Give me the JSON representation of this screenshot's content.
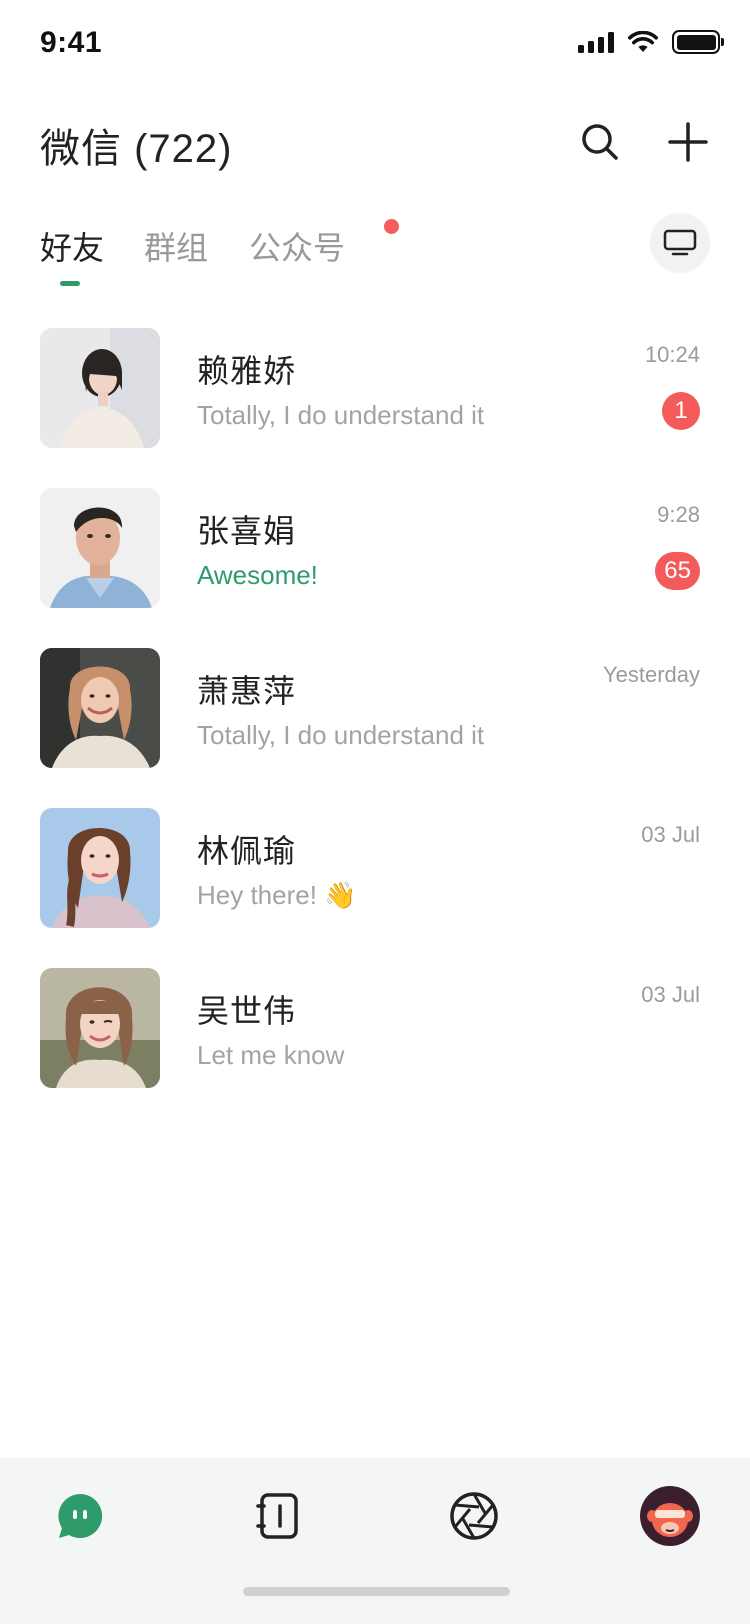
{
  "status_bar": {
    "time": "9:41"
  },
  "header": {
    "title": "微信 (722)",
    "search_icon": "search-icon",
    "add_icon": "plus-icon"
  },
  "tabs": [
    {
      "label": "好友",
      "active": true
    },
    {
      "label": "群组",
      "active": false
    },
    {
      "label": "公众号",
      "active": false,
      "has_dot": true
    }
  ],
  "tv_icon": "monitor-icon",
  "chats": [
    {
      "name": "赖雅娇",
      "preview": "Totally, I do understand it",
      "time": "10:24",
      "unread": "1",
      "preview_accent": false
    },
    {
      "name": "张喜娟",
      "preview": "Awesome!",
      "time": "9:28",
      "unread": "65",
      "preview_accent": true
    },
    {
      "name": "萧惠萍",
      "preview": "Totally, I do understand it",
      "time": "Yesterday",
      "unread": "",
      "preview_accent": false
    },
    {
      "name": "林佩瑜",
      "preview": "Hey there! 👋",
      "time": "03 Jul",
      "unread": "",
      "preview_accent": false
    },
    {
      "name": "吴世伟",
      "preview": "Let me know",
      "time": "03 Jul",
      "unread": "",
      "preview_accent": false
    }
  ],
  "bottom_nav": [
    {
      "icon": "chat-bubble-icon",
      "active": true
    },
    {
      "icon": "contacts-book-icon",
      "active": false
    },
    {
      "icon": "camera-aperture-icon",
      "active": false
    },
    {
      "icon": "monkey-avatar-icon",
      "active": false
    }
  ],
  "colors": {
    "accent": "#2e9c6a",
    "badge": "#f55a5a",
    "nav_background": "#f3f6f4"
  }
}
